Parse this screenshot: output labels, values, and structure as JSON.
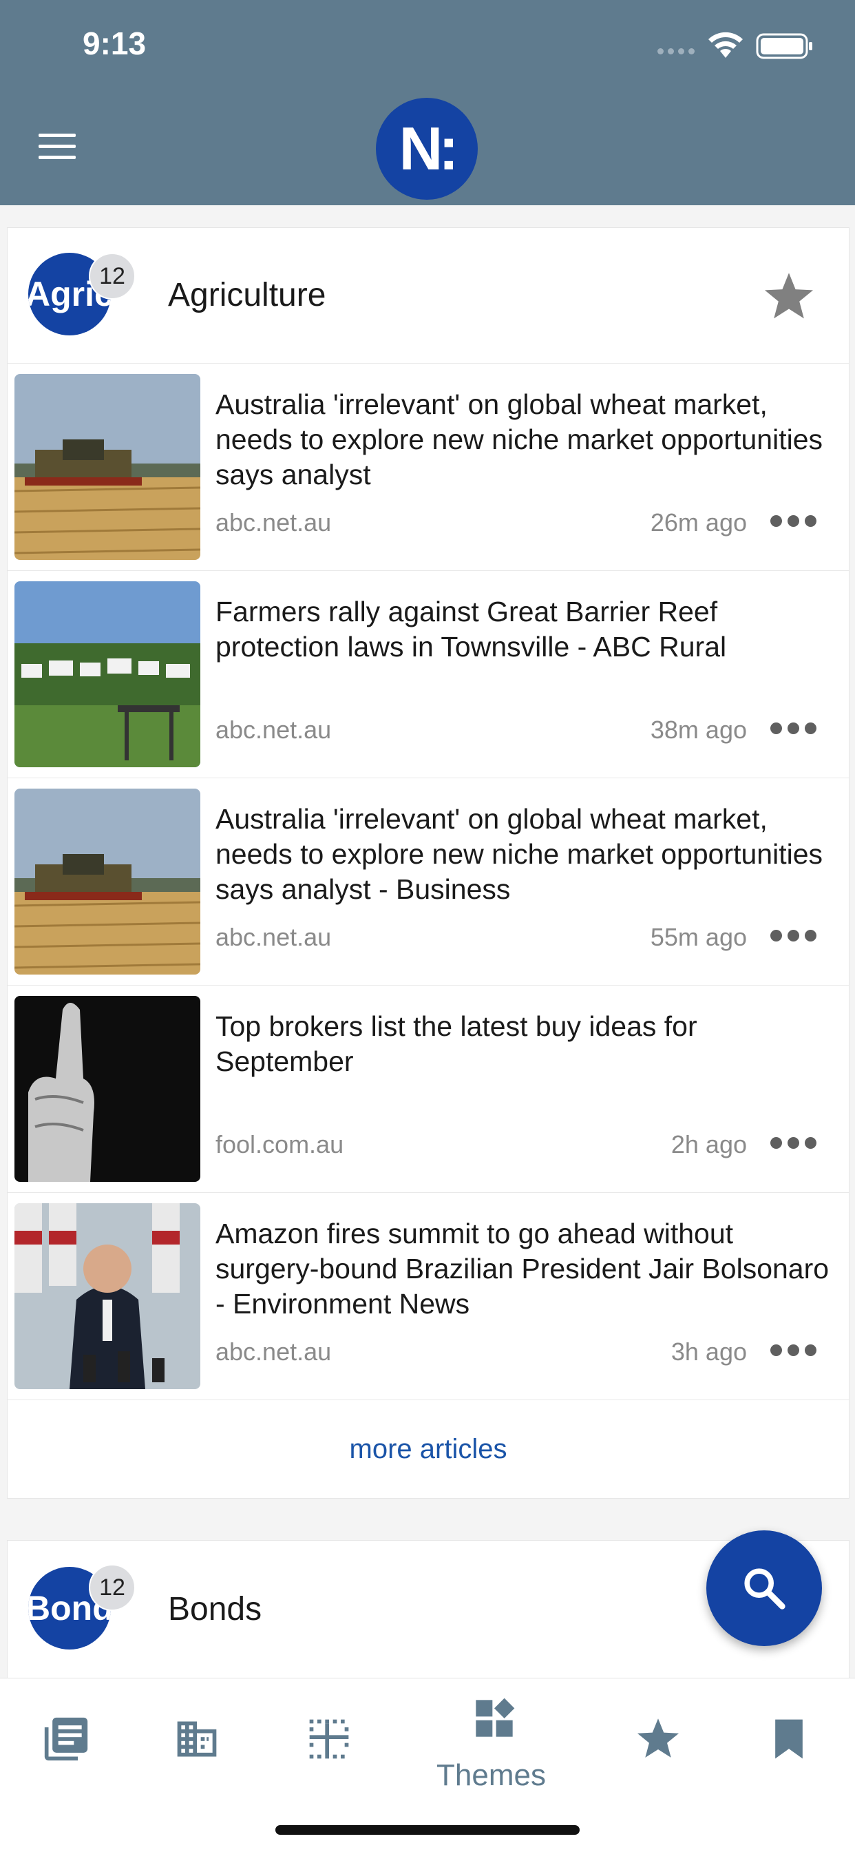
{
  "status_bar": {
    "time": "9:13"
  },
  "header": {
    "logo_text": "N:"
  },
  "categories": [
    {
      "avatar_text": "Agriculture",
      "badge": "12",
      "title": "Agriculture",
      "articles": [
        {
          "headline": "Australia 'irrelevant' on global wheat market, needs to explore new niche market opportunities says analyst",
          "source": "abc.net.au",
          "time": "26m ago",
          "image": "wheat-harvester"
        },
        {
          "headline": "Farmers rally against Great Barrier Reef protection laws in Townsville - ABC Rural",
          "source": "abc.net.au",
          "time": "38m ago",
          "image": "rally-signs"
        },
        {
          "headline": "Australia 'irrelevant' on global wheat market, needs to explore new niche market opportunities says analyst - Business",
          "source": "abc.net.au",
          "time": "55m ago",
          "image": "wheat-harvester"
        },
        {
          "headline": "Top brokers list the latest buy ideas for September",
          "source": "fool.com.au",
          "time": "2h ago",
          "image": "thumbs-up"
        },
        {
          "headline": "Amazon fires summit to go ahead without surgery-bound Brazilian President Jair Bolsonaro - Environment News",
          "source": "abc.net.au",
          "time": "3h ago",
          "image": "president-press"
        }
      ],
      "more_label": "more articles"
    },
    {
      "avatar_text": "Bonds",
      "badge": "12",
      "title": "Bonds"
    }
  ],
  "bottom_nav": {
    "items": [
      {
        "icon": "news-feed-icon"
      },
      {
        "icon": "companies-icon"
      },
      {
        "icon": "sectors-icon"
      },
      {
        "icon": "themes-icon",
        "label": "Themes",
        "active": true
      },
      {
        "icon": "favorites-star-icon"
      },
      {
        "icon": "bookmark-icon"
      }
    ]
  },
  "colors": {
    "header": "#5f7b8e",
    "brand": "#1443a3",
    "link": "#1a54a8"
  }
}
